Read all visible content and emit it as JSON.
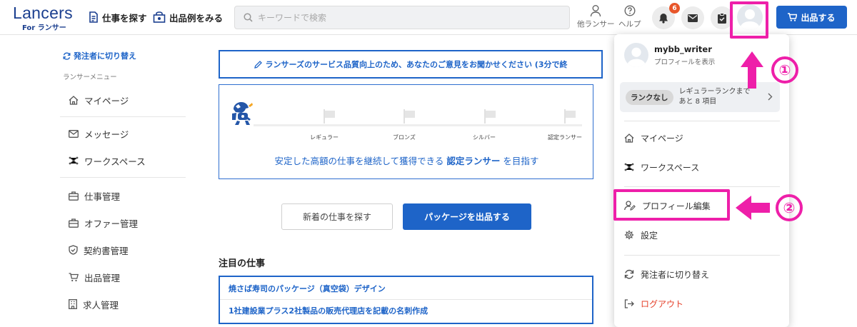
{
  "header": {
    "logo_main": "Lancers",
    "logo_sub": "For ランサー",
    "nav_find_jobs": "仕事を探す",
    "nav_portfolio": "出品例をみる",
    "search_placeholder": "キーワードで検索",
    "other_lancer": "他ランサー",
    "help": "ヘルプ",
    "notification_count": "6",
    "post_button": "出品する"
  },
  "sidebar": {
    "switch_label": "発注者に切り替え",
    "menu_caption": "ランサーメニュー",
    "items": [
      {
        "label": "マイページ",
        "icon": "home-icon"
      },
      {
        "label": "メッセージ",
        "icon": "mail-icon"
      },
      {
        "label": "ワークスペース",
        "icon": "workspace-icon"
      },
      {
        "label": "仕事管理",
        "icon": "briefcase-icon"
      },
      {
        "label": "オファー管理",
        "icon": "briefcase-icon"
      },
      {
        "label": "契約書管理",
        "icon": "shield-icon"
      },
      {
        "label": "出品管理",
        "icon": "cart-icon"
      },
      {
        "label": "求人管理",
        "icon": "building-icon"
      }
    ]
  },
  "main": {
    "survey_text": "ランサーズのサービス品質向上のため、あなたのご意見をお聞かせください (3分で終",
    "ranks": [
      "レギュラー",
      "ブロンズ",
      "シルバー",
      "認定ランサー"
    ],
    "goal_prefix": "安定した高額の仕事を継続して獲得できる",
    "goal_bold": "認定ランサー",
    "goal_suffix": "を目指す",
    "btn_find_new": "新着の仕事を探す",
    "btn_post_package": "パッケージを出品する",
    "featured_title": "注目の仕事",
    "jobs": [
      "焼さば寿司のパッケージ（真空袋）デザイン",
      "1社建設業プラス2社製品の販売代理店を記載の名刺作成"
    ]
  },
  "dropdown": {
    "username": "mybb_writer",
    "view_profile": "プロフィールを表示",
    "rank_pill": "ランクなし",
    "rank_line1": "レギュラーランクまで",
    "rank_line2": "あと 8 項目",
    "items": {
      "mypage": "マイページ",
      "workspace": "ワークスペース",
      "profile_edit": "プロフィール編集",
      "settings": "設定",
      "switch_client": "発注者に切り替え",
      "logout": "ログアウト"
    }
  },
  "annotations": {
    "step1": "①",
    "step2": "②",
    "color": "#ee1fa9"
  },
  "colors": {
    "brand": "#1b3f8f",
    "accent": "#1e64c8",
    "danger": "#e5402a"
  }
}
